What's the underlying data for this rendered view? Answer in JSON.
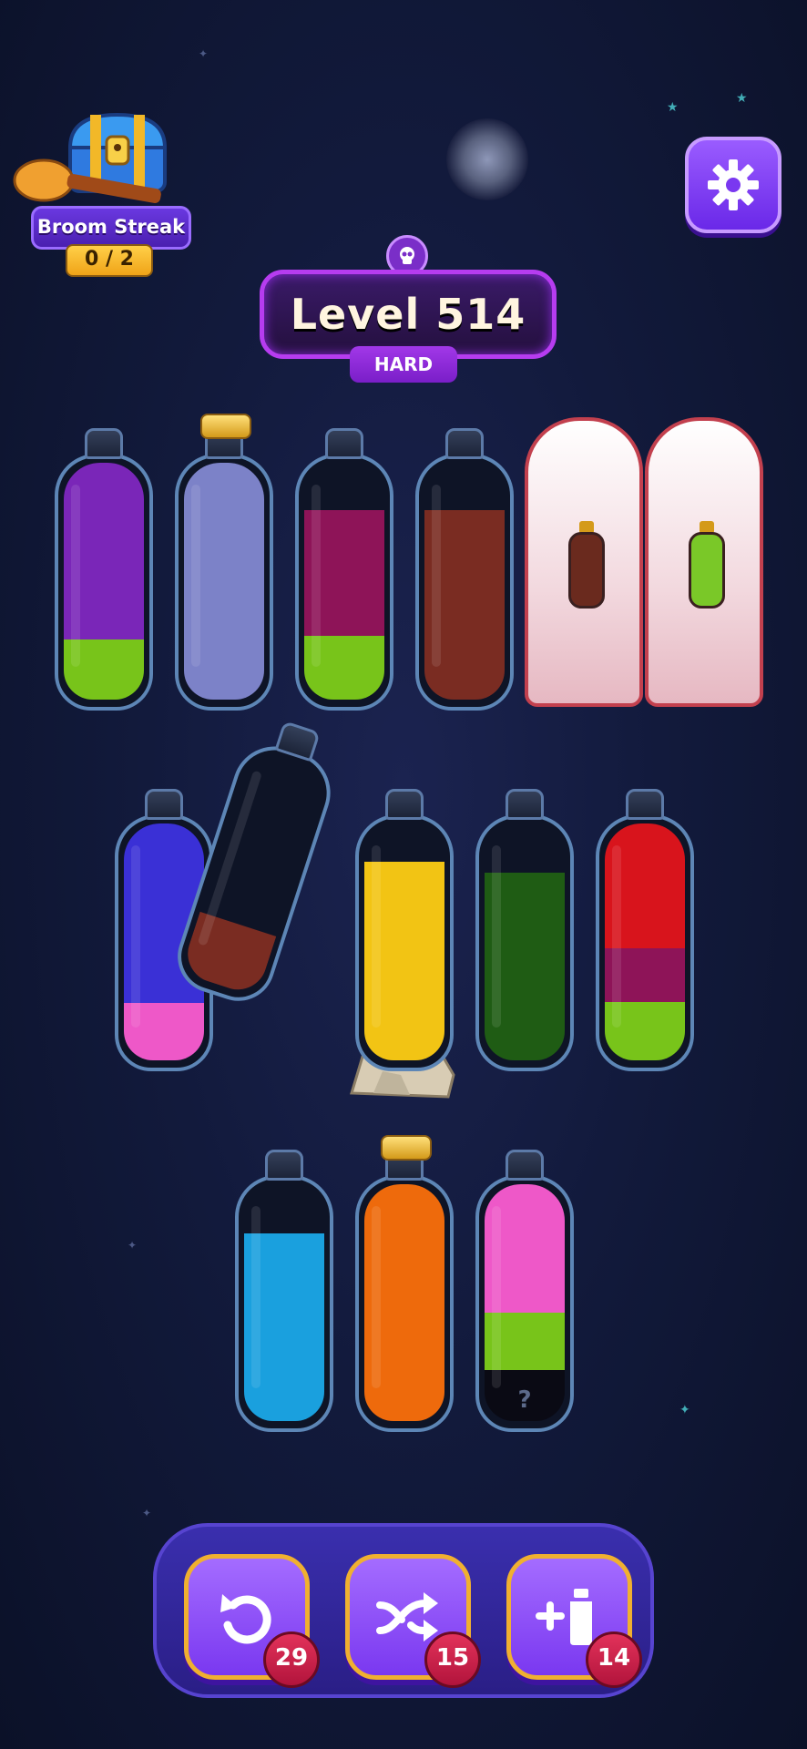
{
  "broom_streak": {
    "label": "Broom Streak",
    "progress": "0 / 2"
  },
  "level": {
    "title": "Level 514",
    "difficulty": "HARD"
  },
  "bottles": [
    {
      "id": "r1-b1",
      "layers": [
        "#7a26b8",
        "#78c41a"
      ]
    },
    {
      "id": "r1-b2",
      "layers": [
        "#7c82c8"
      ],
      "corked": true
    },
    {
      "id": "r1-b3",
      "layers": [
        "#8e1458",
        "#78c41a"
      ]
    },
    {
      "id": "r1-b4",
      "layers": [
        "#7a2c22"
      ]
    },
    {
      "id": "r1-b5",
      "covered": true,
      "hint_color": "#6a2a1e"
    },
    {
      "id": "r1-b6",
      "covered": true,
      "hint_color": "#7ac828"
    },
    {
      "id": "r2-b1",
      "layers": [
        "#3a30d6",
        "#ee58c8"
      ]
    },
    {
      "id": "r2-b2",
      "layers": [
        "#7a2c22"
      ],
      "tilted": true
    },
    {
      "id": "r2-b3",
      "layers": [
        "#f2c414"
      ],
      "rocks": true
    },
    {
      "id": "r2-b4",
      "layers": [
        "#1f5c14"
      ]
    },
    {
      "id": "r2-b5",
      "layers": [
        "#d8141c",
        "#8e1458",
        "#78c41a"
      ]
    },
    {
      "id": "r3-b1",
      "layers": [
        "#1aa0de"
      ]
    },
    {
      "id": "r3-b2",
      "layers": [
        "#ee6a0c"
      ],
      "corked": true
    },
    {
      "id": "r3-b3",
      "layers": [
        "#ee58c8",
        "#78c41a",
        "#0a0a14"
      ],
      "hidden_layer": "?"
    }
  ],
  "toolbar": {
    "undo": {
      "icon": "undo-icon",
      "count": "29"
    },
    "shuffle": {
      "icon": "shuffle-icon",
      "count": "15"
    },
    "add_bottle": {
      "icon": "add-bottle-icon",
      "count": "14"
    }
  }
}
